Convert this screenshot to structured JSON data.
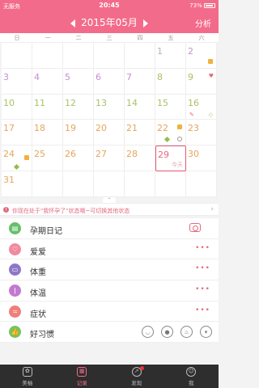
{
  "status_bar": {
    "carrier": "无服务",
    "time": "20:45",
    "battery": "73%"
  },
  "header": {
    "month": "2015年05月",
    "analysis": "分析"
  },
  "weekdays": [
    "日",
    "一",
    "二",
    "三",
    "四",
    "五",
    "六"
  ],
  "calendar": {
    "days": [
      "",
      "",
      "",
      "",
      "",
      "1",
      "2",
      "3",
      "4",
      "5",
      "6",
      "7",
      "8",
      "9",
      "10",
      "11",
      "12",
      "13",
      "14",
      "15",
      "16",
      "17",
      "18",
      "19",
      "20",
      "21",
      "22",
      "23",
      "24",
      "25",
      "26",
      "27",
      "28",
      "29",
      "30",
      "31",
      "",
      "",
      "",
      "",
      "",
      ""
    ],
    "today_label": "今天"
  },
  "state_bar": {
    "text": "你现在处于\"我怀孕了\"状态哦~可切换其他状态"
  },
  "list": {
    "items": [
      {
        "label": "孕期日记",
        "icon": "diary-icon",
        "color": "#66c06a"
      },
      {
        "label": "爱爱",
        "icon": "heart-icon",
        "color": "#f08aa0"
      },
      {
        "label": "体重",
        "icon": "scale-icon",
        "color": "#8e78c9"
      },
      {
        "label": "体温",
        "icon": "thermometer-icon",
        "color": "#c27ad0"
      },
      {
        "label": "症状",
        "icon": "symptom-icon",
        "color": "#ef7f7a"
      },
      {
        "label": "好习惯",
        "icon": "thumbs-up-icon",
        "color": "#7cc15e"
      }
    ]
  },
  "tabbar": {
    "tabs": [
      {
        "label": "美柚",
        "icon": "meiyou-icon"
      },
      {
        "label": "记录",
        "icon": "calendar-icon"
      },
      {
        "label": "发现",
        "icon": "compass-icon"
      },
      {
        "label": "我",
        "icon": "profile-icon"
      }
    ]
  },
  "colors": {
    "brand": "#f36b8a",
    "accent_red": "#e36a7f",
    "tabbar_bg": "#2e2e2e"
  }
}
